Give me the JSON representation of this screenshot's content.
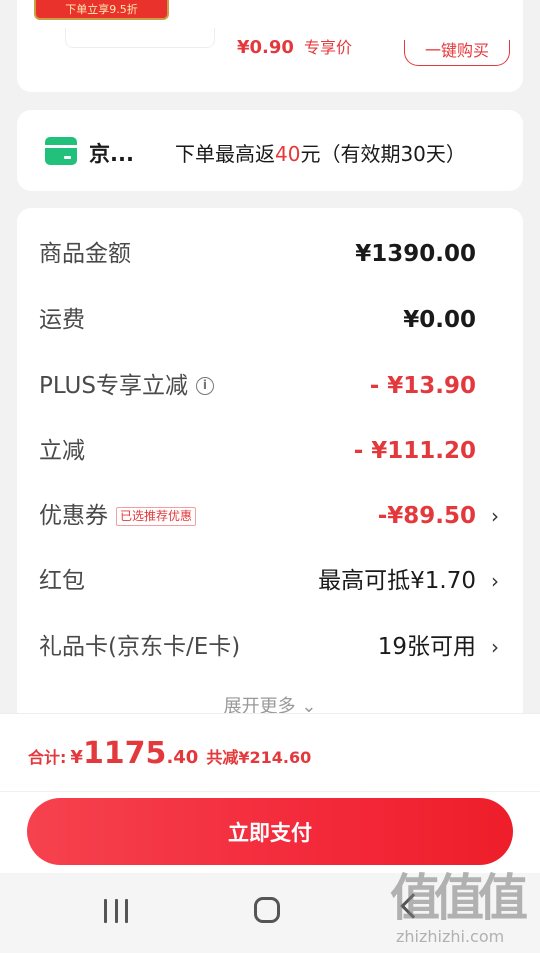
{
  "top_product": {
    "promo_tag": "下单立享9.5折",
    "price": "¥0.90",
    "price_label": "专享价",
    "buy_button": "一键购买"
  },
  "jd_card": {
    "name": "京...",
    "info_prefix": "下单最高返",
    "info_amount": "40",
    "info_suffix": "元（有效期30天）"
  },
  "details": {
    "goods_amount": {
      "label": "商品金额",
      "value": "¥1390.00"
    },
    "shipping": {
      "label": "运费",
      "value": "¥0.00"
    },
    "plus_discount": {
      "label": "PLUS专享立减",
      "info_icon": "i",
      "value": "- ¥13.90"
    },
    "instant_discount": {
      "label": "立减",
      "value": "- ¥111.20"
    },
    "coupon": {
      "label": "优惠券",
      "badge": "已选推荐优惠",
      "value": "-¥89.50",
      "chevron": "›"
    },
    "red_packet": {
      "label": "红包",
      "value": "最高可抵¥1.70",
      "chevron": "›"
    },
    "gift_card": {
      "label": "礼品卡(京东卡/E卡)",
      "value": "19张可用",
      "chevron": "›"
    },
    "expand_more": "展开更多 ⌄"
  },
  "bottom": {
    "total_label": "合计:",
    "currency": "¥",
    "total_int": "1175",
    "total_dec": ".40",
    "total_saved": "共减¥214.60",
    "pay_button": "立即支付"
  },
  "watermark": {
    "logo": "值值值",
    "url": "zhizhizhi.com"
  },
  "colors": {
    "accent": "#e4393c",
    "card_green": "#21c07b"
  }
}
